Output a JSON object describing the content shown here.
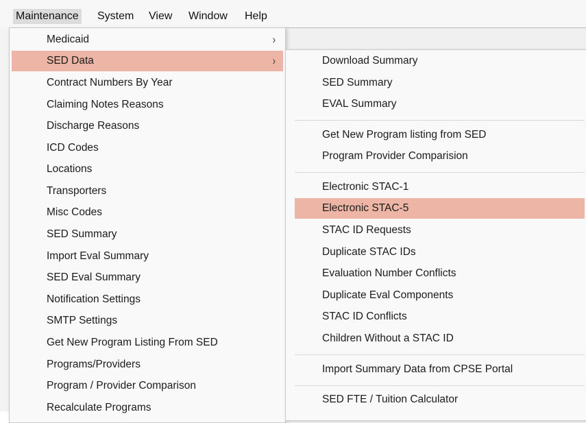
{
  "menubar": {
    "items": [
      {
        "label": "Maintenance"
      },
      {
        "label": "System"
      },
      {
        "label": "View"
      },
      {
        "label": "Window"
      },
      {
        "label": "Help"
      }
    ]
  },
  "main_menu": {
    "items": [
      {
        "label": "Medicaid",
        "has_submenu": true
      },
      {
        "label": "SED Data",
        "has_submenu": true,
        "highlighted": true
      },
      {
        "label": "Contract Numbers By Year"
      },
      {
        "label": "Claiming Notes Reasons"
      },
      {
        "label": "Discharge Reasons"
      },
      {
        "label": "ICD Codes"
      },
      {
        "label": "Locations"
      },
      {
        "label": "Transporters"
      },
      {
        "label": "Misc Codes"
      },
      {
        "label": "SED Summary"
      },
      {
        "label": "Import Eval Summary"
      },
      {
        "label": "SED Eval Summary"
      },
      {
        "label": "Notification Settings"
      },
      {
        "label": "SMTP Settings"
      },
      {
        "label": "Get New Program Listing From SED"
      },
      {
        "label": "Programs/Providers"
      },
      {
        "label": "Program / Provider Comparison"
      },
      {
        "label": "Recalculate Programs"
      }
    ],
    "arrow_glyph": "›"
  },
  "sub_menu": {
    "items": [
      {
        "label": "Download Summary"
      },
      {
        "label": "SED Summary"
      },
      {
        "label": "EVAL Summary"
      },
      {
        "label": "Get New Program listing from SED"
      },
      {
        "label": "Program Provider Comparision"
      },
      {
        "label": "Electronic STAC-1"
      },
      {
        "label": "Electronic STAC-5",
        "highlighted": true
      },
      {
        "label": "STAC ID Requests"
      },
      {
        "label": "Duplicate STAC IDs"
      },
      {
        "label": "Evaluation Number Conflicts"
      },
      {
        "label": "Duplicate Eval Components"
      },
      {
        "label": "STAC ID Conflicts"
      },
      {
        "label": "Children Without a STAC ID"
      },
      {
        "label": "Import Summary Data from CPSE Portal"
      },
      {
        "label": "SED FTE / Tuition Calculator"
      }
    ]
  },
  "colors": {
    "highlight": "#ecb5a5",
    "menu_background": "#f9f9f9",
    "menubar_background": "#f7f7f7"
  }
}
